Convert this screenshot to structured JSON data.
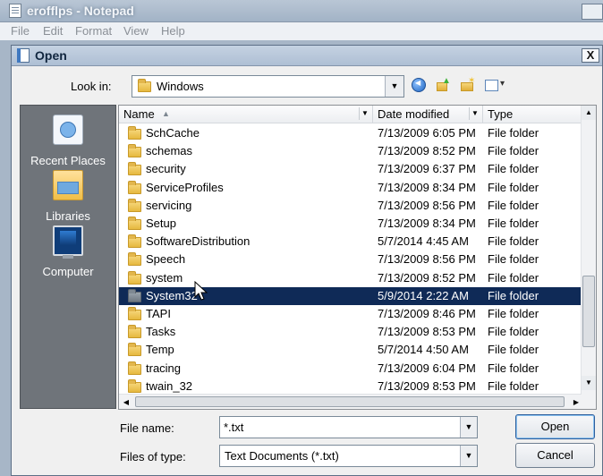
{
  "notepad": {
    "title": "erofflps - Notepad",
    "menu": [
      "File",
      "Edit",
      "Format",
      "View",
      "Help"
    ]
  },
  "dialog": {
    "title": "Open",
    "close_label": "X",
    "look_in_label": "Look in:",
    "look_in_value": "Windows",
    "places": [
      "Recent Places",
      "Libraries",
      "Computer"
    ],
    "columns": {
      "name": "Name",
      "date": "Date modified",
      "type": "Type"
    },
    "files": [
      {
        "name": "SchCache",
        "date": "7/13/2009 6:05 PM",
        "type": "File folder"
      },
      {
        "name": "schemas",
        "date": "7/13/2009 8:52 PM",
        "type": "File folder"
      },
      {
        "name": "security",
        "date": "7/13/2009 6:37 PM",
        "type": "File folder"
      },
      {
        "name": "ServiceProfiles",
        "date": "7/13/2009 8:34 PM",
        "type": "File folder"
      },
      {
        "name": "servicing",
        "date": "7/13/2009 8:56 PM",
        "type": "File folder"
      },
      {
        "name": "Setup",
        "date": "7/13/2009 8:34 PM",
        "type": "File folder"
      },
      {
        "name": "SoftwareDistribution",
        "date": "5/7/2014 4:45 AM",
        "type": "File folder"
      },
      {
        "name": "Speech",
        "date": "7/13/2009 8:56 PM",
        "type": "File folder"
      },
      {
        "name": "system",
        "date": "7/13/2009 8:52 PM",
        "type": "File folder"
      },
      {
        "name": "System32",
        "date": "5/9/2014 2:22 AM",
        "type": "File folder",
        "selected": true
      },
      {
        "name": "TAPI",
        "date": "7/13/2009 8:46 PM",
        "type": "File folder"
      },
      {
        "name": "Tasks",
        "date": "7/13/2009 8:53 PM",
        "type": "File folder"
      },
      {
        "name": "Temp",
        "date": "5/7/2014 4:50 AM",
        "type": "File folder"
      },
      {
        "name": "tracing",
        "date": "7/13/2009 6:04 PM",
        "type": "File folder"
      },
      {
        "name": "twain_32",
        "date": "7/13/2009 8:53 PM",
        "type": "File folder"
      }
    ],
    "file_name_label": "File name:",
    "file_name_value": "*.txt",
    "file_type_label": "Files of type:",
    "file_type_value": "Text Documents (*.txt)",
    "open_label": "Open",
    "cancel_label": "Cancel"
  },
  "colors": {
    "selection": "#0f2a57",
    "places_bg": "#6f747a",
    "desktop": "#1f3f6a"
  },
  "icons": [
    "notepad-icon",
    "folder-icon",
    "back-icon",
    "up-folder-icon",
    "new-folder-icon",
    "views-icon",
    "recent-places-icon",
    "libraries-icon",
    "computer-icon",
    "mouse-cursor-icon"
  ]
}
